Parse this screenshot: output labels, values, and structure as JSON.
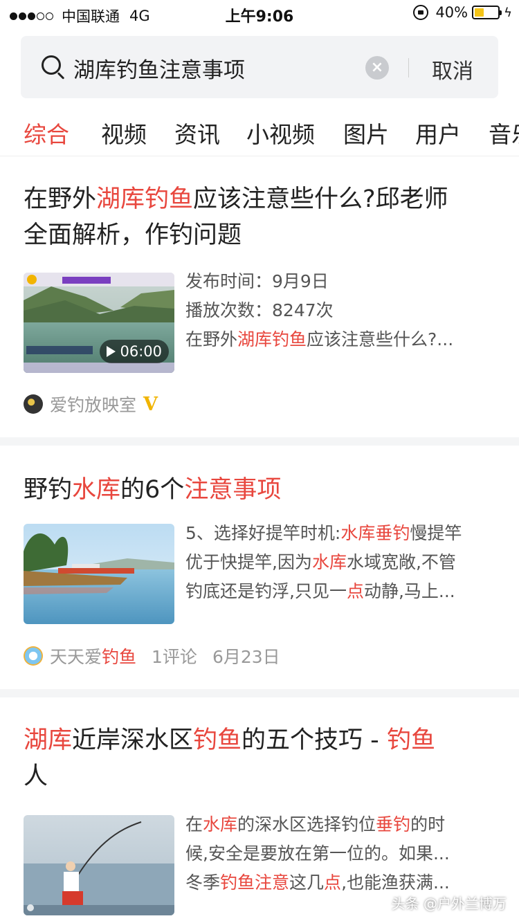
{
  "status_bar": {
    "carrier": "中国联通",
    "network": "4G",
    "time": "上午9:06",
    "battery_percent": "40%",
    "battery_level": 0.4,
    "icons": [
      "signal-icon",
      "orientation-lock-icon",
      "battery-icon",
      "charging-icon"
    ]
  },
  "search": {
    "query": "湖库钓鱼注意事项",
    "cancel_label": "取消",
    "clear_symbol": "×"
  },
  "tabs": [
    {
      "label": "综合",
      "active": true
    },
    {
      "label": "视频",
      "active": false
    },
    {
      "label": "资讯",
      "active": false
    },
    {
      "label": "小视频",
      "active": false
    },
    {
      "label": "图片",
      "active": false
    },
    {
      "label": "用户",
      "active": false
    },
    {
      "label": "音乐",
      "active": false
    }
  ],
  "results": [
    {
      "title_line1": {
        "pre": "在野外",
        "hl": "湖库钓鱼",
        "post": "应该注意些什么?邱老师"
      },
      "title_line2": "全面解析，作钓问题",
      "meta": {
        "publish_label": "发布时间：",
        "publish_value": "9月9日",
        "plays_label": "播放次数：",
        "plays_value": "8247次",
        "snippet_pre": "在野外",
        "snippet_hl": "湖库钓鱼",
        "snippet_post": "应该注意些什么?..."
      },
      "duration": "06:00",
      "source": "爱钓放映室",
      "verified_mark": "V"
    },
    {
      "title": {
        "pre": "野钓",
        "hl1": "水库",
        "mid": "的6个",
        "hl2": "注意事项"
      },
      "snippet": {
        "l1_pre": "5、选择好提竿时机:",
        "l1_hl": "水库垂钓",
        "l1_post": "慢提竿",
        "l2_pre": "优于快提竿,因为",
        "l2_hl": "水库",
        "l2_post": "水域宽敞,不管",
        "l3_pre": "钓底还是钓浮,只见一",
        "l3_hl": "点",
        "l3_post": "动静,马上..."
      },
      "source_pre": "天天爱",
      "source_hl": "钓鱼",
      "comments": "1评论",
      "date": "6月23日"
    },
    {
      "title_line1": {
        "hl1": "湖库",
        "mid1": "近岸深水区",
        "hl2": "钓鱼",
        "mid2": "的五个技巧 - ",
        "hl3": "钓鱼"
      },
      "title_line2": "人",
      "snippet": {
        "l1_pre": "在",
        "l1_hl1": "水库",
        "l1_mid": "的深水区选择钓位",
        "l1_hl2": "垂钓",
        "l1_post": "的时",
        "l2": "候,安全是要放在第一位的。如果...",
        "l3_pre": "冬季",
        "l3_hl1": "钓鱼注意",
        "l3_mid": "这几",
        "l3_hl2": "点",
        "l3_post": ",也能渔获满..."
      }
    }
  ],
  "watermark": "头条 @户外兰博万"
}
